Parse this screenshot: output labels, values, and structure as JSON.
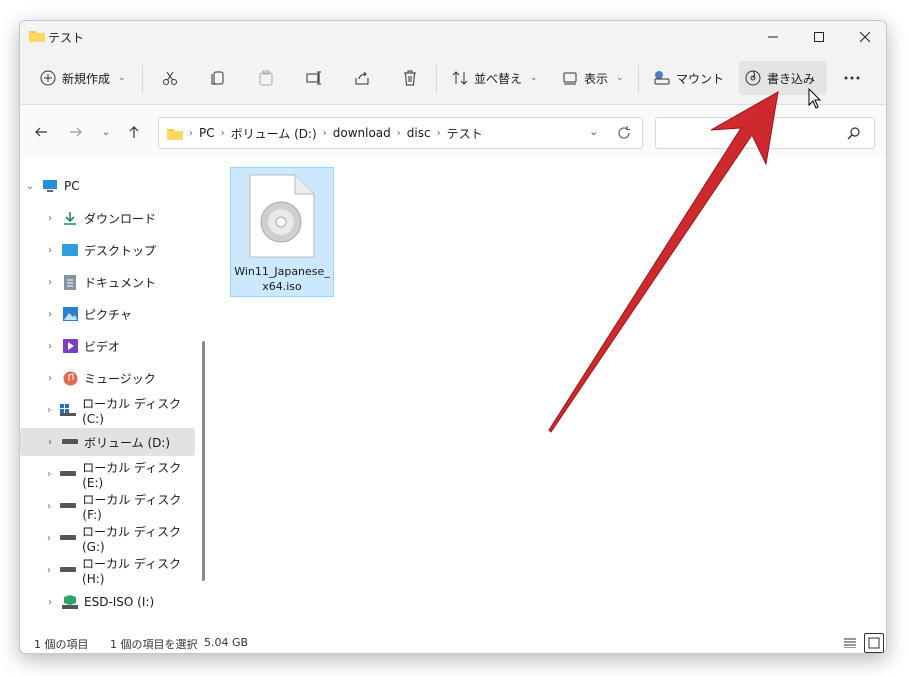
{
  "window": {
    "title": "テスト"
  },
  "toolbar": {
    "new_label": "新規作成",
    "sort_label": "並べ替え",
    "view_label": "表示",
    "mount_label": "マウント",
    "burn_label": "書き込み"
  },
  "address": {
    "crumbs": [
      "PC",
      "ボリューム (D:)",
      "download",
      "disc",
      "テスト"
    ]
  },
  "sidebar": {
    "items": [
      {
        "label": "PC",
        "icon": "pc-icon"
      },
      {
        "label": "ダウンロード",
        "icon": "download-icon"
      },
      {
        "label": "デスクトップ",
        "icon": "desktop-icon"
      },
      {
        "label": "ドキュメント",
        "icon": "document-icon"
      },
      {
        "label": "ピクチャ",
        "icon": "picture-icon"
      },
      {
        "label": "ビデオ",
        "icon": "video-icon"
      },
      {
        "label": "ミュージック",
        "icon": "music-icon"
      },
      {
        "label": "ローカル ディスク (C:)",
        "icon": "windows-drive-icon"
      },
      {
        "label": "ボリューム (D:)",
        "icon": "drive-icon"
      },
      {
        "label": "ローカル ディスク (E:)",
        "icon": "drive-icon"
      },
      {
        "label": "ローカル ディスク (F:)",
        "icon": "drive-icon"
      },
      {
        "label": "ローカル ディスク (G:)",
        "icon": "drive-icon"
      },
      {
        "label": "ローカル ディスク (H:)",
        "icon": "drive-icon"
      },
      {
        "label": "ESD-ISO (I:)",
        "icon": "disc-drive-icon"
      }
    ]
  },
  "file": {
    "name_line1": "Win11_Japanese_",
    "name_line2": "x64.iso"
  },
  "status": {
    "count": "1 個の項目",
    "selected": "1 個の項目を選択",
    "size": "5.04 GB"
  },
  "colors": {
    "accent": "#cce8ff",
    "arrow": "#d0262a"
  }
}
